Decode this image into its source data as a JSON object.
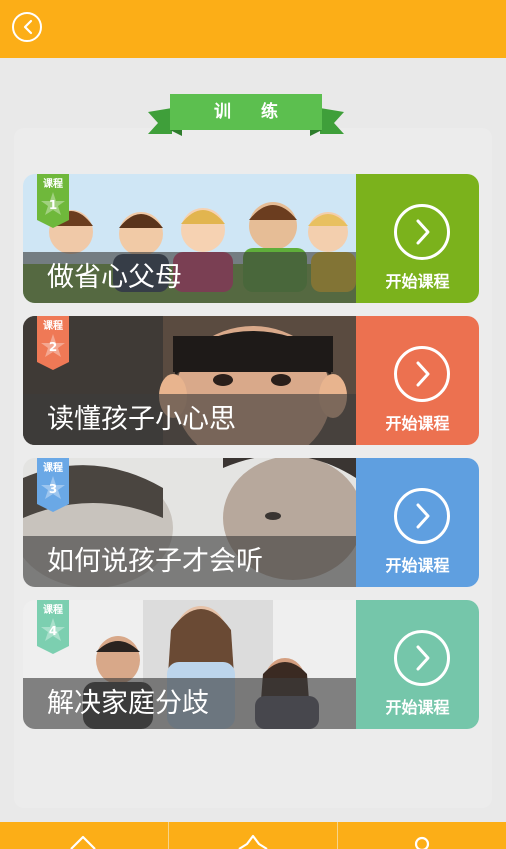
{
  "header": {
    "back_icon": "chevron-left-icon"
  },
  "section": {
    "title": "训 练"
  },
  "courses": [
    {
      "badge": "课程",
      "number": "1",
      "title": "做省心父母",
      "action": "开始课程",
      "color": "#7bb21c",
      "ribbon_color": "#6fb83b"
    },
    {
      "badge": "课程",
      "number": "2",
      "title": "读懂孩子小心思",
      "action": "开始课程",
      "color": "#ec7150",
      "ribbon_color": "#ef7956"
    },
    {
      "badge": "课程",
      "number": "3",
      "title": "如何说孩子才会听",
      "action": "开始课程",
      "color": "#5f9fe0",
      "ribbon_color": "#6aa8e6"
    },
    {
      "badge": "课程",
      "number": "4",
      "title": "解决家庭分歧",
      "action": "开始课程",
      "color": "#75c6aa",
      "ribbon_color": "#7ccfb0"
    }
  ],
  "bottom_nav": [
    {
      "icon": "home-icon"
    },
    {
      "icon": "star-icon"
    },
    {
      "icon": "user-icon"
    }
  ],
  "colors": {
    "accent": "#fcae17",
    "banner": "#5cbf4f"
  }
}
